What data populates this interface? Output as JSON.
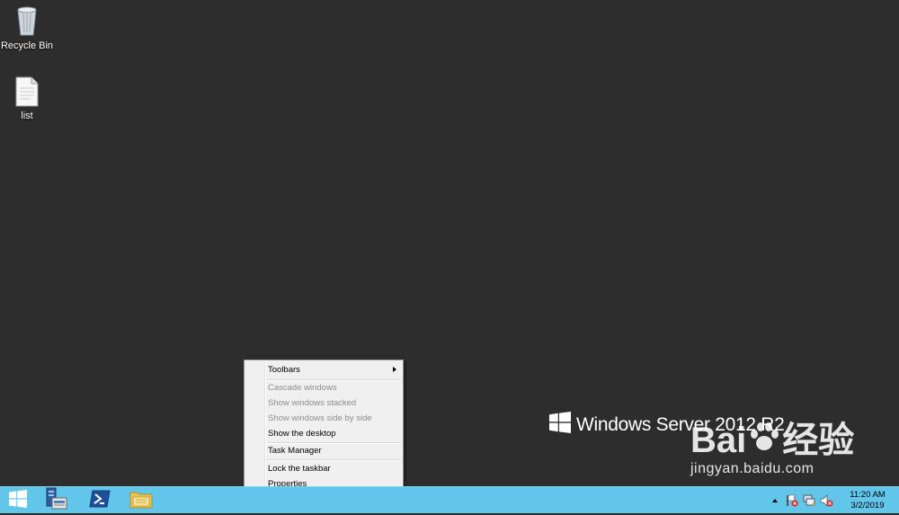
{
  "desktop": {
    "icons": [
      {
        "label": "Recycle Bin"
      },
      {
        "label": "list"
      }
    ],
    "brand_text": "Windows Server 2012 R2",
    "watermark": {
      "logo_left": "Bai",
      "logo_right": "经验",
      "url": "jingyan.baidu.com"
    }
  },
  "context_menu": {
    "items": [
      {
        "label": "Toolbars",
        "enabled": true,
        "submenu": true
      },
      {
        "label": "Cascade windows",
        "enabled": false
      },
      {
        "label": "Show windows stacked",
        "enabled": false
      },
      {
        "label": "Show windows side by side",
        "enabled": false
      },
      {
        "label": "Show the desktop",
        "enabled": true
      },
      {
        "label": "Task Manager",
        "enabled": true
      },
      {
        "label": "Lock the taskbar",
        "enabled": true
      },
      {
        "label": "Properties",
        "enabled": true
      }
    ]
  },
  "taskbar": {
    "pinned": [
      {
        "icon": "start-windows-icon"
      },
      {
        "icon": "server-manager-icon"
      },
      {
        "icon": "powershell-icon"
      },
      {
        "icon": "file-explorer-icon"
      }
    ],
    "tray": {
      "icons": [
        "show-hidden-icons-arrow",
        "action-center-flag-icon",
        "network-icon",
        "volume-muted-icon"
      ],
      "time": "11:20 AM",
      "date": "3/2/2019"
    },
    "color": "#62c6ea"
  },
  "colors": {
    "desktop_bg": "#2d2d2d",
    "menu_bg": "#f0f0f0",
    "disabled_text": "#8d8d8d"
  }
}
